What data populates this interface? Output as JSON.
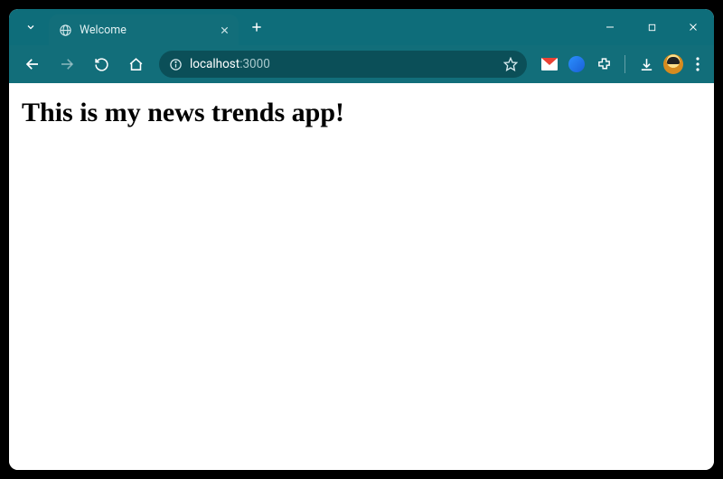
{
  "window": {
    "tab_title": "Welcome"
  },
  "address": {
    "host": "localhost",
    "port": ":3000"
  },
  "page": {
    "heading": "This is my news trends app!"
  }
}
